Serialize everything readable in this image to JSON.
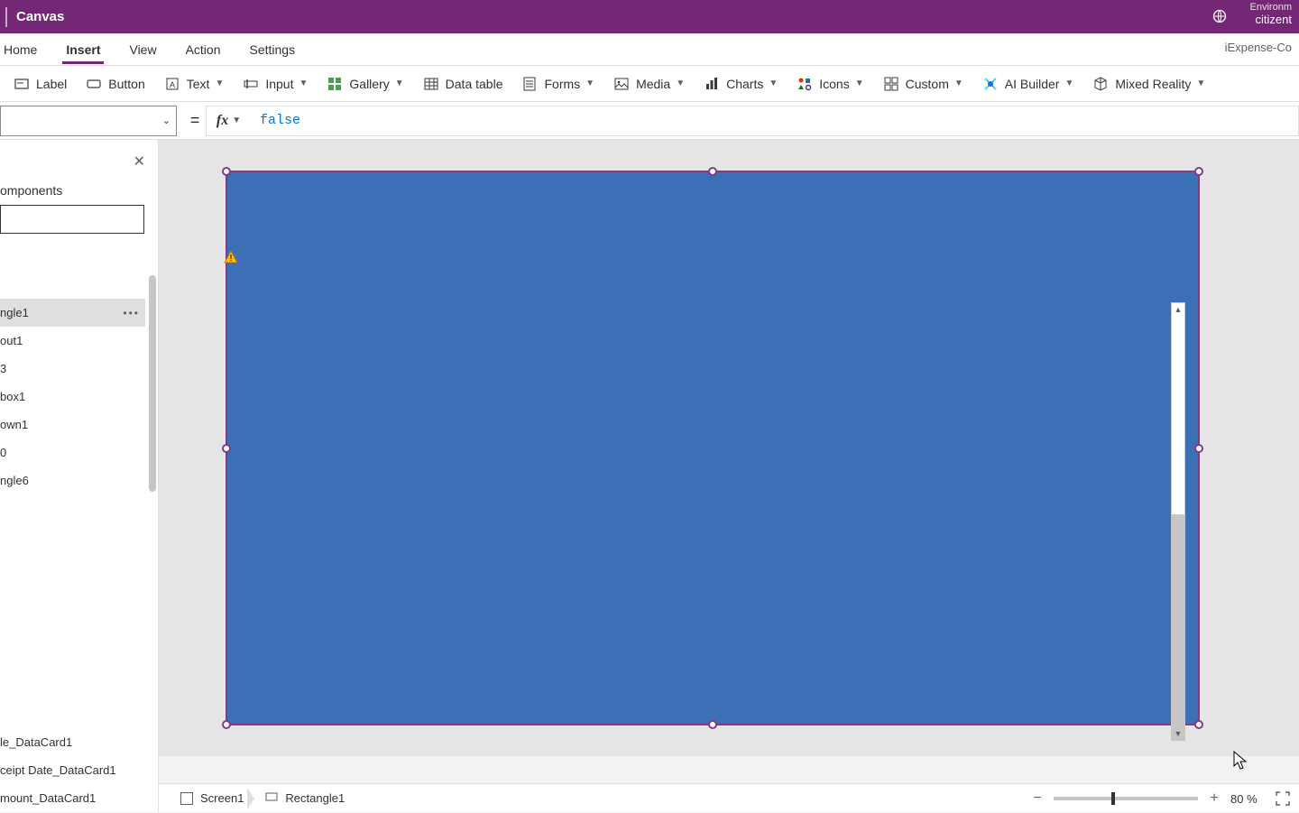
{
  "titlebar": {
    "title": "Canvas",
    "env_label": "Environm",
    "env_value": "citizent"
  },
  "menu": {
    "items": [
      "Home",
      "Insert",
      "View",
      "Action",
      "Settings"
    ],
    "active_index": 1
  },
  "file_name": "iExpense-Co",
  "ribbon": {
    "label": "Label",
    "button": "Button",
    "text": "Text",
    "input": "Input",
    "gallery": "Gallery",
    "datatable": "Data table",
    "forms": "Forms",
    "media": "Media",
    "charts": "Charts",
    "icons": "Icons",
    "custom": "Custom",
    "aibuilder": "AI Builder",
    "mixedreality": "Mixed Reality"
  },
  "formula": {
    "fx": "fx",
    "eq": "=",
    "value": "false"
  },
  "tree": {
    "tab": "omponents",
    "items": [
      "ngle1",
      "out1",
      "3",
      "box1",
      "own1",
      "0",
      "ngle6"
    ],
    "selected_index": 0,
    "bottom_items": [
      "le_DataCard1",
      "ceipt Date_DataCard1",
      "mount_DataCard1"
    ]
  },
  "breadcrumb": {
    "screen": "Screen1",
    "control": "Rectangle1"
  },
  "zoom": {
    "percent": "80",
    "unit": "%"
  },
  "colors": {
    "accent": "#742774",
    "shape_fill": "#3b6fb6"
  }
}
